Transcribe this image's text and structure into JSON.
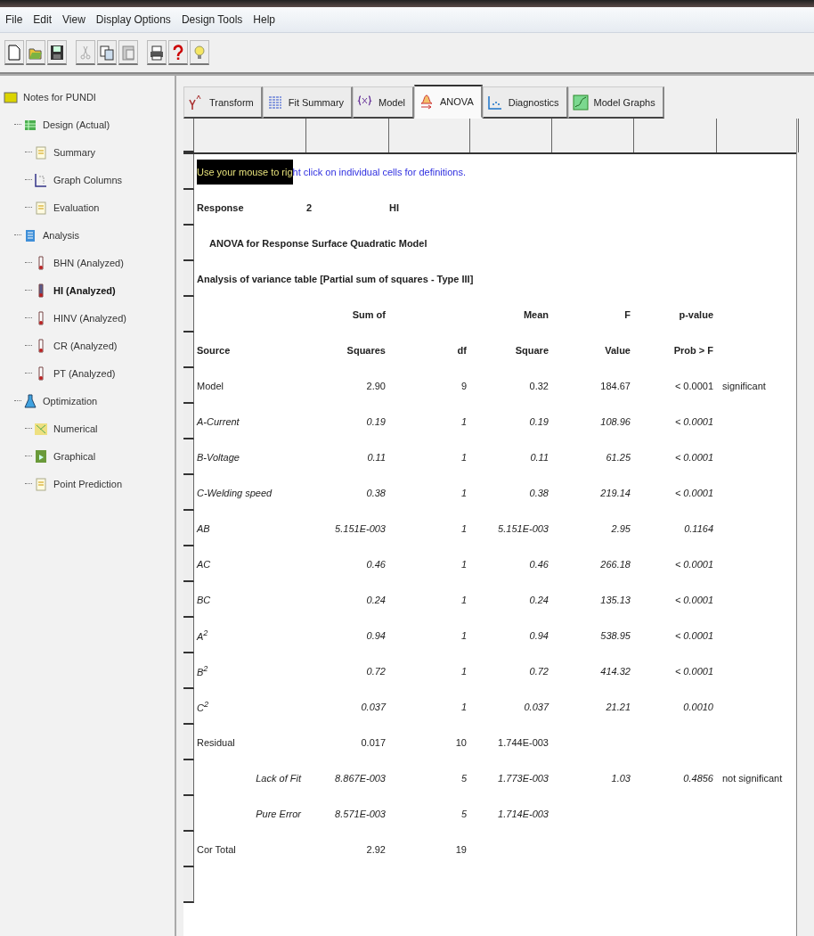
{
  "menu": [
    "File",
    "Edit",
    "View",
    "Display Options",
    "Design Tools",
    "Help"
  ],
  "sidebar": {
    "items": [
      {
        "label": "Notes for PUNDI",
        "kind": "notes",
        "selected": false,
        "children": [
          {
            "label": "Design (Actual)",
            "kind": "design",
            "selected": false,
            "children": [
              {
                "label": "Summary",
                "kind": "summary",
                "selected": false
              },
              {
                "label": "Graph Columns",
                "kind": "graph",
                "selected": false
              },
              {
                "label": "Evaluation",
                "kind": "evaluation",
                "selected": false
              }
            ]
          },
          {
            "label": "Analysis",
            "kind": "analysis",
            "selected": false,
            "children": [
              {
                "label": "BHN (Analyzed)",
                "kind": "response",
                "selected": false
              },
              {
                "label": "HI (Analyzed)",
                "kind": "response",
                "selected": true
              },
              {
                "label": "HINV (Analyzed)",
                "kind": "response",
                "selected": false
              },
              {
                "label": "CR (Analyzed)",
                "kind": "response",
                "selected": false
              },
              {
                "label": "PT (Analyzed)",
                "kind": "response",
                "selected": false
              }
            ]
          },
          {
            "label": "Optimization",
            "kind": "optimization",
            "selected": false,
            "children": [
              {
                "label": "Numerical",
                "kind": "numerical",
                "selected": false
              },
              {
                "label": "Graphical",
                "kind": "graphical",
                "selected": false
              },
              {
                "label": "Point Prediction",
                "kind": "prediction",
                "selected": false
              }
            ]
          }
        ]
      }
    ]
  },
  "tabs": [
    {
      "label": "Transform",
      "selected": false
    },
    {
      "label": "Fit Summary",
      "selected": false
    },
    {
      "label": "Model",
      "selected": false
    },
    {
      "label": "ANOVA",
      "selected": true
    },
    {
      "label": "Diagnostics",
      "selected": false
    },
    {
      "label": "Model Graphs",
      "selected": false
    }
  ],
  "report": {
    "hint": {
      "highlighted": "Use your mouse to rig",
      "text": "ht click on individual cells for definitions."
    },
    "response": {
      "label": "Response",
      "number": "2",
      "name": "HI"
    },
    "title": "ANOVA for Response Surface Quadratic Model",
    "subtitle": "Analysis of variance table [Partial sum of squares - Type III]",
    "header_top": {
      "sum": "Sum of",
      "mean": "Mean",
      "f": "F",
      "p": "p-value"
    },
    "header": {
      "source": "Source",
      "sum": "Squares",
      "df": "df",
      "mean": "Square",
      "f": "Value",
      "p": "Prob > F"
    },
    "rows": [
      {
        "kind": "main",
        "source": "Model",
        "sum": "2.90",
        "df": "9",
        "mean": "0.32",
        "f": "184.67",
        "p": "< 0.0001",
        "note": "significant"
      },
      {
        "kind": "term",
        "source": "A-Current",
        "sum": "0.19",
        "df": "1",
        "mean": "0.19",
        "f": "108.96",
        "p": "< 0.0001"
      },
      {
        "kind": "term",
        "source": "B-Voltage",
        "sum": "0.11",
        "df": "1",
        "mean": "0.11",
        "f": "61.25",
        "p": "< 0.0001"
      },
      {
        "kind": "term",
        "source": "C-Welding speed",
        "sum": "0.38",
        "df": "1",
        "mean": "0.38",
        "f": "219.14",
        "p": "< 0.0001"
      },
      {
        "kind": "term",
        "source": "AB",
        "sum": "5.151E-003",
        "df": "1",
        "mean": "5.151E-003",
        "f": "2.95",
        "p": "0.1164"
      },
      {
        "kind": "term",
        "source": "AC",
        "sum": "0.46",
        "df": "1",
        "mean": "0.46",
        "f": "266.18",
        "p": "< 0.0001"
      },
      {
        "kind": "term",
        "source": "BC",
        "sum": "0.24",
        "df": "1",
        "mean": "0.24",
        "f": "135.13",
        "p": "< 0.0001"
      },
      {
        "kind": "term",
        "source": "A$^{2}$",
        "sum": "0.94",
        "df": "1",
        "mean": "0.94",
        "f": "538.95",
        "p": "< 0.0001"
      },
      {
        "kind": "term",
        "source": "B$^{2}$",
        "sum": "0.72",
        "df": "1",
        "mean": "0.72",
        "f": "414.32",
        "p": "< 0.0001"
      },
      {
        "kind": "term",
        "source": "C$^{2}$",
        "sum": "0.037",
        "df": "1",
        "mean": "0.037",
        "f": "21.21",
        "p": "0.0010"
      },
      {
        "kind": "main",
        "source": "Residual",
        "sum": "0.017",
        "df": "10",
        "mean": "1.744E-003"
      },
      {
        "kind": "sub",
        "source": "Lack of Fit",
        "sum": "8.867E-003",
        "df": "5",
        "mean": "1.773E-003",
        "f": "1.03",
        "p": "0.4856",
        "note": "not significant"
      },
      {
        "kind": "sub",
        "source": "Pure Error",
        "sum": "8.571E-003",
        "df": "5",
        "mean": "1.714E-003"
      },
      {
        "kind": "main",
        "source": "Cor Total",
        "sum": "2.92",
        "df": "19"
      }
    ]
  }
}
